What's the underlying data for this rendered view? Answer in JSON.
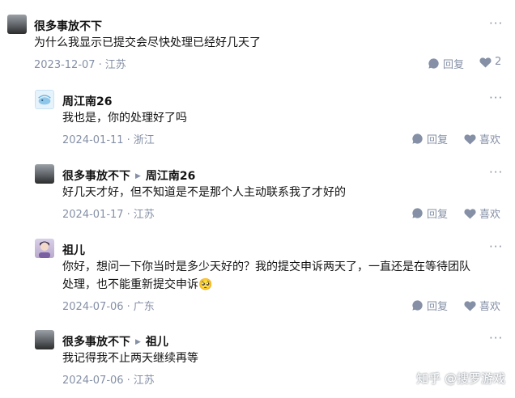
{
  "comments": [
    {
      "author": "很多事放不下",
      "reply_to": "",
      "text": "为什么我显示已提交会尽快处理已经好几天了",
      "date": "2023-12-07",
      "location": "江苏",
      "reply_label": "回复",
      "like_label": "2"
    },
    {
      "author": "周江南26",
      "reply_to": "",
      "text": "我也是，你的处理好了吗",
      "date": "2024-01-11",
      "location": "浙江",
      "reply_label": "回复",
      "like_label": "喜欢"
    },
    {
      "author": "很多事放不下",
      "reply_to": "周江南26",
      "text": "好几天才好，但不知道是不是那个人主动联系我了才好的",
      "date": "2024-01-17",
      "location": "江苏",
      "reply_label": "回复",
      "like_label": "喜欢"
    },
    {
      "author": "祖儿",
      "reply_to": "",
      "text_line1": "你好，想问一下你当时是多少天好的？我的提交申诉两天了，一直还是在等待团队",
      "text_line2": "处理，也不能重新提交申诉🥺",
      "date": "2024-07-06",
      "location": "广东",
      "reply_label": "回复",
      "like_label": "喜欢"
    },
    {
      "author": "很多事放不下",
      "reply_to": "祖儿",
      "text": "我记得我不止两天继续再等",
      "date": "2024-07-06",
      "location": "江苏"
    }
  ],
  "more_label": "···",
  "meta_separator": "·",
  "watermark": "知乎 @搜罗游戏",
  "colors": {
    "text": "#121212",
    "meta": "#8590a6",
    "background": "#ffffff"
  }
}
